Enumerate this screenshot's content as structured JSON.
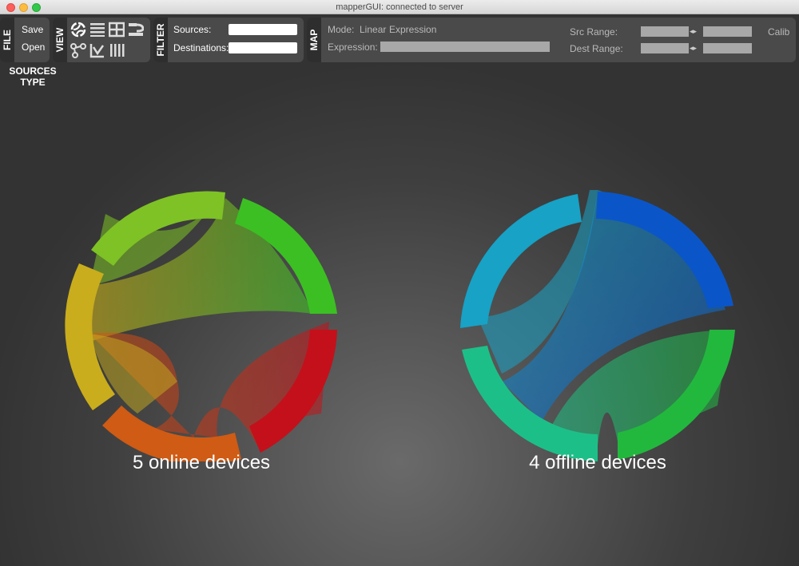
{
  "window": {
    "title": "mapperGUI: connected to server"
  },
  "toolbar": {
    "file": {
      "label": "FILE",
      "save": "Save",
      "open": "Open"
    },
    "view": {
      "label": "VIEW",
      "icons": [
        "chord-view-icon",
        "list-view-icon",
        "grid-view-icon",
        "hive-view-icon",
        "graph-view-icon",
        "balloon-view-icon",
        "parallel-view-icon"
      ]
    },
    "filter": {
      "label": "FILTER",
      "sources_label": "Sources:",
      "sources_value": "",
      "destinations_label": "Destinations:",
      "destinations_value": ""
    },
    "map": {
      "label": "MAP",
      "mode_label": "Mode:",
      "mode_linear": "Linear",
      "mode_expression": "Expression",
      "expression_label": "Expression:",
      "expression_value": "",
      "src_range_label": "Src Range:",
      "dest_range_label": "Dest Range:",
      "calib": "Calib"
    }
  },
  "sources_type": {
    "line1": "SOURCES",
    "line2": "TYPE"
  },
  "online": {
    "caption": "5 online devices",
    "count": 5,
    "colors": [
      "#7ec225",
      "#3cbf23",
      "#c4101a",
      "#cf5b14",
      "#c9ad1c"
    ]
  },
  "offline": {
    "caption": "4 offline devices",
    "count": 4,
    "colors": [
      "#0a56c8",
      "#22b83e",
      "#1dbf88",
      "#17a2c6"
    ]
  }
}
